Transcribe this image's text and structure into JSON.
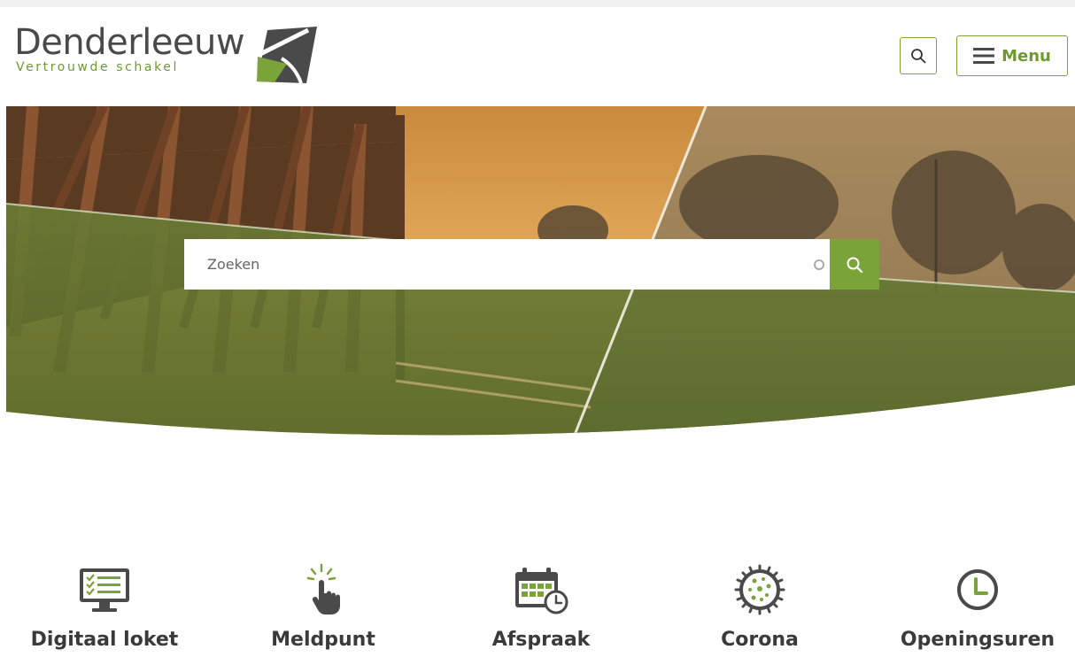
{
  "site": {
    "name": "Denderleeuw",
    "tagline": "Vertrouwde schakel",
    "brand_color": "#7aa33a",
    "logo_colors": [
      "#4a4a4a",
      "#7aa33a"
    ]
  },
  "header": {
    "search_icon": "search-icon",
    "menu_icon": "hamburger-icon",
    "menu_label": "Menu"
  },
  "hero": {
    "search": {
      "placeholder": "Zoeken",
      "value": "",
      "submit_icon": "search-icon"
    }
  },
  "quick_links": [
    {
      "label": "Digitaal loket",
      "icon": "monitor-checklist-icon"
    },
    {
      "label": "Meldpunt",
      "icon": "pointing-hand-icon"
    },
    {
      "label": "Afspraak",
      "icon": "calendar-clock-icon"
    },
    {
      "label": "Corona",
      "icon": "virus-icon"
    },
    {
      "label": "Openingsuren",
      "icon": "clock-icon"
    }
  ]
}
